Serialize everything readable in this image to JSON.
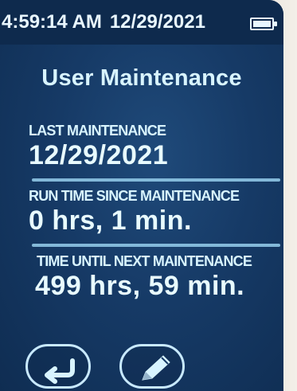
{
  "status_bar": {
    "time": "4:59:14 AM",
    "date": "12/29/2021",
    "battery_level": 1.0,
    "battery_icon": "battery-full-icon"
  },
  "screen": {
    "title": "User Maintenance",
    "sections": [
      {
        "label": "LAST MAINTENANCE",
        "value": "12/29/2021"
      },
      {
        "label": "RUN TIME SINCE MAINTENANCE",
        "value": "0 hrs, 1 min."
      },
      {
        "label": "TIME UNTIL NEXT MAINTENANCE",
        "value": "499 hrs, 59 min."
      }
    ]
  },
  "buttons": {
    "back_icon": "return-arrow-icon",
    "edit_icon": "pencil-icon"
  },
  "colors": {
    "screen_bg": "#163a66",
    "statusbar_bg": "#0e2a4d",
    "text": "#d8f4ff",
    "accent_line": "#8fc6e6"
  }
}
